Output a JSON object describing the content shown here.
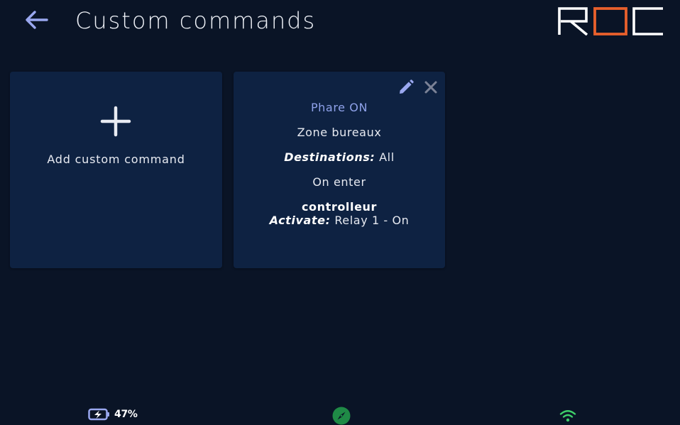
{
  "header": {
    "title": "Custom commands",
    "logo_text": "ROC"
  },
  "add_card": {
    "label": "Add custom command"
  },
  "command_card": {
    "name": "Phare ON",
    "zone": "Zone bureaux",
    "destinations_label": "Destinations:",
    "destinations_value": "All",
    "trigger": "On enter",
    "device": "controlleur",
    "action_label": "Activate:",
    "action_value": "Relay 1 - On"
  },
  "status_bar": {
    "battery_percent": "47%",
    "battery_charging": true
  },
  "colors": {
    "background": "#0a1426",
    "card": "#0e2242",
    "accent": "#8fa2ea",
    "logo_orange": "#e8602c",
    "status_green": "#3ecf6a"
  },
  "icons": {
    "back": "arrow-left-icon",
    "add": "plus-icon",
    "edit": "pencil-icon",
    "close": "close-icon",
    "battery": "battery-charging-icon",
    "compass": "compass-icon",
    "wifi": "wifi-icon"
  }
}
